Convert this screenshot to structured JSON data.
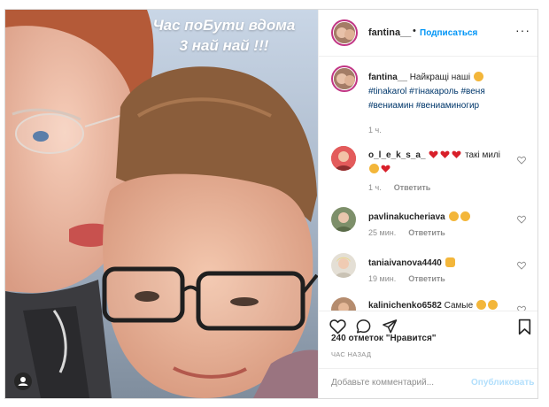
{
  "photo": {
    "story_text": "Час поБути вдома\n3 най най !!!"
  },
  "header": {
    "username": "fantina__",
    "separator": "•",
    "follow_label": "Подписаться"
  },
  "caption": {
    "username": "fantina__",
    "text": "Найкращі наші",
    "hashtags": [
      "#tinakarol",
      "#тінакароль",
      "#веня",
      "#вениамин",
      "#вениаминогир"
    ],
    "time": "1 ч."
  },
  "comments": [
    {
      "username": "o_l_e_k_s_a_",
      "text": "такі милі",
      "time": "1 ч.",
      "reply_label": "Ответить"
    },
    {
      "username": "pavlinakucheriava",
      "text": "",
      "time": "25 мин.",
      "reply_label": "Ответить"
    },
    {
      "username": "taniaivanova4440",
      "text": "",
      "time": "19 мин.",
      "reply_label": "Ответить"
    },
    {
      "username": "kalinichenko6582",
      "text": "Самые",
      "time": "",
      "reply_label": ""
    }
  ],
  "actions": {
    "likes_text": "240 отметок \"Нравится\"",
    "timestamp": "ЧАС НАЗАД"
  },
  "add_comment": {
    "placeholder": "Добавьте комментарий...",
    "publish_label": "Опубликовать"
  },
  "icons": {
    "like": "heart-outline-icon",
    "comment": "comment-bubble-icon",
    "share": "paper-plane-icon",
    "save": "bookmark-icon",
    "tag": "user-tag-icon"
  },
  "colors": {
    "accent": "#0095f6",
    "hashtag": "#00376b",
    "muted": "#8e8e8e",
    "publish_disabled": "#b2dffc",
    "story_ring": "#c13584"
  }
}
